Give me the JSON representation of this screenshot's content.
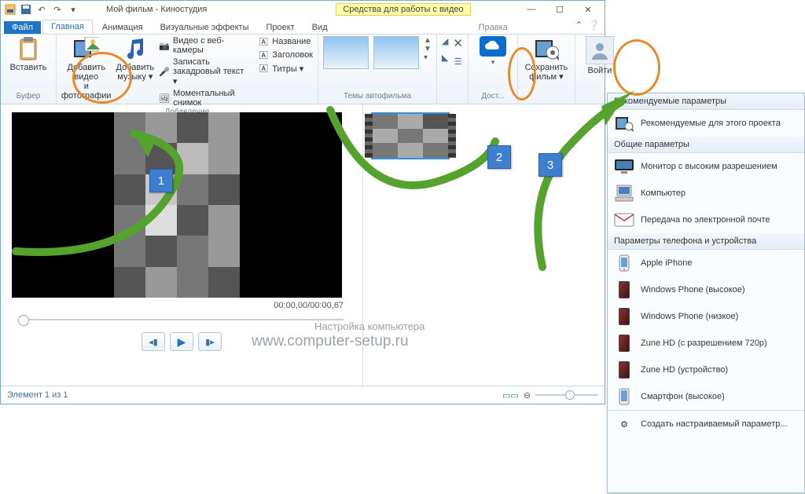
{
  "title": "Мой фильм - Киностудия",
  "tool_title": "Средства для работы с видео",
  "tabs": {
    "file": "Файл",
    "home": "Главная",
    "anim": "Анимация",
    "fx": "Визуальные эффекты",
    "project": "Проект",
    "view": "Вид",
    "edit": "Правка"
  },
  "ribbon": {
    "buffer": {
      "paste": "Вставить",
      "label": "Буфер"
    },
    "add": {
      "video_photo": "Добавить видео\nи фотографии",
      "add_music": "Добавить\nмузыку ▾",
      "webcam": "Видео с веб-камеры",
      "narration": "Записать закадровый текст ▾",
      "snapshot": "Моментальный снимок",
      "title": "Название",
      "caption": "Заголовок",
      "credits": "Титры ▾",
      "label": "Добавление"
    },
    "themes": {
      "label": "Темы автофильма"
    },
    "share": {
      "label": "Дост..."
    },
    "save": {
      "label": "Сохранить\nфильм ▾"
    },
    "signin": {
      "label": "Войти"
    }
  },
  "preview": {
    "timecode": "00:00,00/00:00,67"
  },
  "status": {
    "left": "Элемент 1 из 1"
  },
  "menu": {
    "h1": "Рекомендуемые параметры",
    "rec": "Рекомендуемые для этого проекта",
    "h2": "Общие параметры",
    "hd": "Монитор с высоким разрешением",
    "pc": "Компьютер",
    "email": "Передача по электронной почте",
    "h3": "Параметры телефона и устройства",
    "iphone": "Apple iPhone",
    "wp_hi": "Windows Phone (высокое)",
    "wp_lo": "Windows Phone (низкое)",
    "zune720": "Zune HD (с разрешением 720p)",
    "zune": "Zune HD (устройство)",
    "smart": "Смартфон (высокое)",
    "footer": "Создать настраиваемый параметр..."
  },
  "watermark": {
    "l1": "Настройка компьютера",
    "l2": "www.computer-setup.ru"
  },
  "ann": {
    "n1": "1",
    "n2": "2",
    "n3": "3"
  }
}
